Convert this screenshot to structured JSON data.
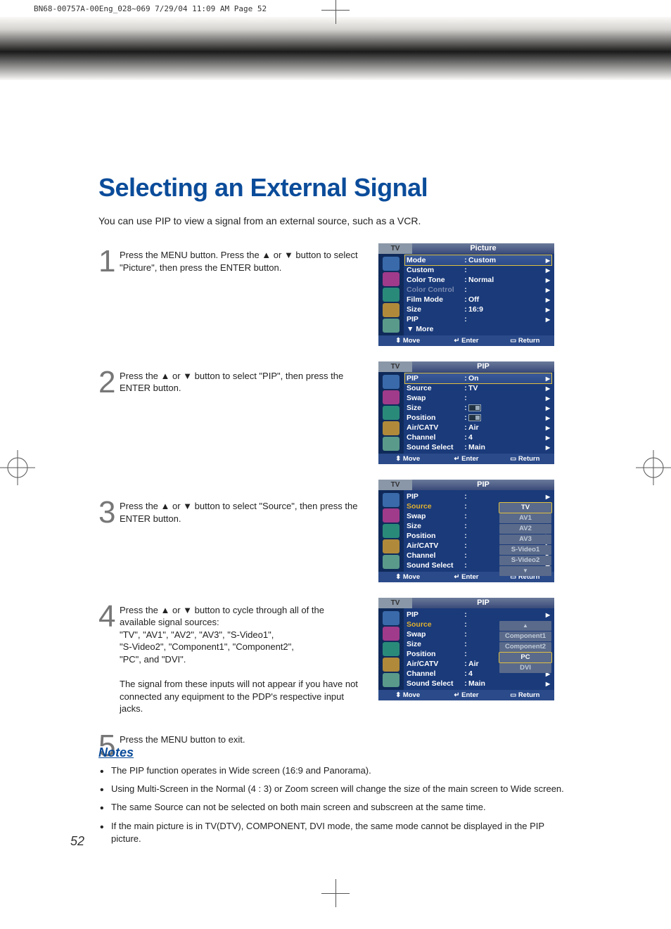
{
  "slug": "BN68-00757A-00Eng_028~069  7/29/04  11:09 AM  Page 52",
  "title": "Selecting an External Signal",
  "intro": "You can use PIP to view a signal from an external source, such as a VCR.",
  "page_number": "52",
  "steps": [
    {
      "num": "1",
      "text": "Press the MENU button. Press the ▲ or ▼ button to select \"Picture\", then press the ENTER button."
    },
    {
      "num": "2",
      "text": "Press the ▲ or ▼ button to select \"PIP\", then press the ENTER button."
    },
    {
      "num": "3",
      "text": "Press the ▲ or ▼ button to select \"Source\", then press the ENTER button."
    },
    {
      "num": "4",
      "text": "Press the ▲ or ▼ button to cycle through all of the available signal sources:\n\"TV\", \"AV1\", \"AV2\", \"AV3\", \"S-Video1\",\n\"S-Video2\", \"Component1\", \"Component2\",\n\"PC\", and \"DVI\".\n\nThe signal from these inputs will not appear if you have not connected any equipment to the PDP's respective input jacks."
    },
    {
      "num": "5",
      "text": "Press the MENU button to exit."
    }
  ],
  "osd_common": {
    "tv": "TV",
    "foot_move": "Move",
    "foot_enter": "Enter",
    "foot_return": "Return",
    "more": "▼ More"
  },
  "osd1": {
    "title": "Picture",
    "rows": [
      {
        "lbl": "Mode",
        "val": "Custom",
        "hl": true
      },
      {
        "lbl": "Custom",
        "val": ""
      },
      {
        "lbl": "Color Tone",
        "val": "Normal"
      },
      {
        "lbl": "Color Control",
        "val": "",
        "dim": true
      },
      {
        "lbl": "Film Mode",
        "val": "Off"
      },
      {
        "lbl": "Size",
        "val": "16:9"
      },
      {
        "lbl": "PIP",
        "val": ""
      }
    ]
  },
  "osd2": {
    "title": "PIP",
    "rows": [
      {
        "lbl": "PIP",
        "val": "On",
        "hl": true
      },
      {
        "lbl": "Source",
        "val": "TV"
      },
      {
        "lbl": "Swap",
        "val": ""
      },
      {
        "lbl": "Size",
        "val": "",
        "thumb": true
      },
      {
        "lbl": "Position",
        "val": "",
        "thumb": true
      },
      {
        "lbl": "Air/CATV",
        "val": "Air"
      },
      {
        "lbl": "Channel",
        "val": "4"
      },
      {
        "lbl": "Sound Select",
        "val": "Main"
      }
    ]
  },
  "osd3": {
    "title": "PIP",
    "rows": [
      {
        "lbl": "PIP"
      },
      {
        "lbl": "Source",
        "src": true
      },
      {
        "lbl": "Swap"
      },
      {
        "lbl": "Size"
      },
      {
        "lbl": "Position"
      },
      {
        "lbl": "Air/CATV"
      },
      {
        "lbl": "Channel"
      },
      {
        "lbl": "Sound Select"
      }
    ],
    "opts": [
      {
        "t": "TV",
        "sel": true
      },
      {
        "t": "AV1"
      },
      {
        "t": "AV2"
      },
      {
        "t": "AV3"
      },
      {
        "t": "S-Video1"
      },
      {
        "t": "S-Video2"
      },
      {
        "t": "▼",
        "arrow": true
      }
    ]
  },
  "osd4": {
    "title": "PIP",
    "rows": [
      {
        "lbl": "PIP"
      },
      {
        "lbl": "Source",
        "src": true
      },
      {
        "lbl": "Swap"
      },
      {
        "lbl": "Size"
      },
      {
        "lbl": "Position"
      },
      {
        "lbl": "Air/CATV",
        "val": "Air"
      },
      {
        "lbl": "Channel",
        "val": "4"
      },
      {
        "lbl": "Sound Select",
        "val": "Main"
      }
    ],
    "opts": [
      {
        "t": "▲",
        "arrow": true
      },
      {
        "t": "Component1"
      },
      {
        "t": "Component2"
      },
      {
        "t": "PC",
        "sel": true
      },
      {
        "t": "DVI"
      }
    ]
  },
  "notes_title": "Notes",
  "notes": [
    "The PIP function operates in Wide screen (16:9 and Panorama).",
    "Using Multi-Screen in the Normal (4 : 3) or Zoom screen will change the size of the main screen to Wide screen.",
    "The same Source can not be selected on both main screen and subscreen at the same time.",
    "If the main picture is in TV(DTV), COMPONENT, DVI mode, the same mode cannot be displayed in the PIP picture."
  ]
}
